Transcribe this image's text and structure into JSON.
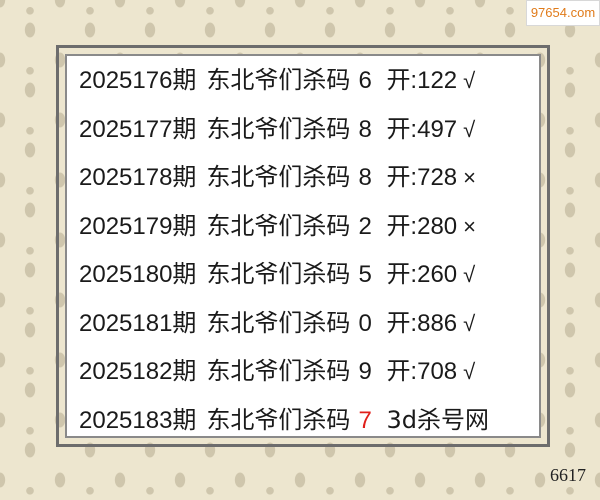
{
  "watermark": {
    "text": "97654.com",
    "color": "#e07b1a"
  },
  "rows": [
    {
      "period": "2025176期",
      "label": "东北爷们杀码",
      "code": "6",
      "result": "开:122",
      "mark": "√"
    },
    {
      "period": "2025177期",
      "label": "东北爷们杀码",
      "code": "8",
      "result": "开:497",
      "mark": "√"
    },
    {
      "period": "2025178期",
      "label": "东北爷们杀码",
      "code": "8",
      "result": "开:728",
      "mark": "×"
    },
    {
      "period": "2025179期",
      "label": "东北爷们杀码",
      "code": "2",
      "result": "开:280",
      "mark": "×"
    },
    {
      "period": "2025180期",
      "label": "东北爷们杀码",
      "code": "5",
      "result": "开:260",
      "mark": "√"
    },
    {
      "period": "2025181期",
      "label": "东北爷们杀码",
      "code": "0",
      "result": "开:886",
      "mark": "√"
    },
    {
      "period": "2025182期",
      "label": "东北爷们杀码",
      "code": "9",
      "result": "开:708",
      "mark": "√"
    }
  ],
  "current": {
    "period": "2025183期",
    "label": "东北爷们杀码",
    "code": "7",
    "code_color": "#e0201b",
    "site": "3d杀号网"
  },
  "page_number": "6617"
}
